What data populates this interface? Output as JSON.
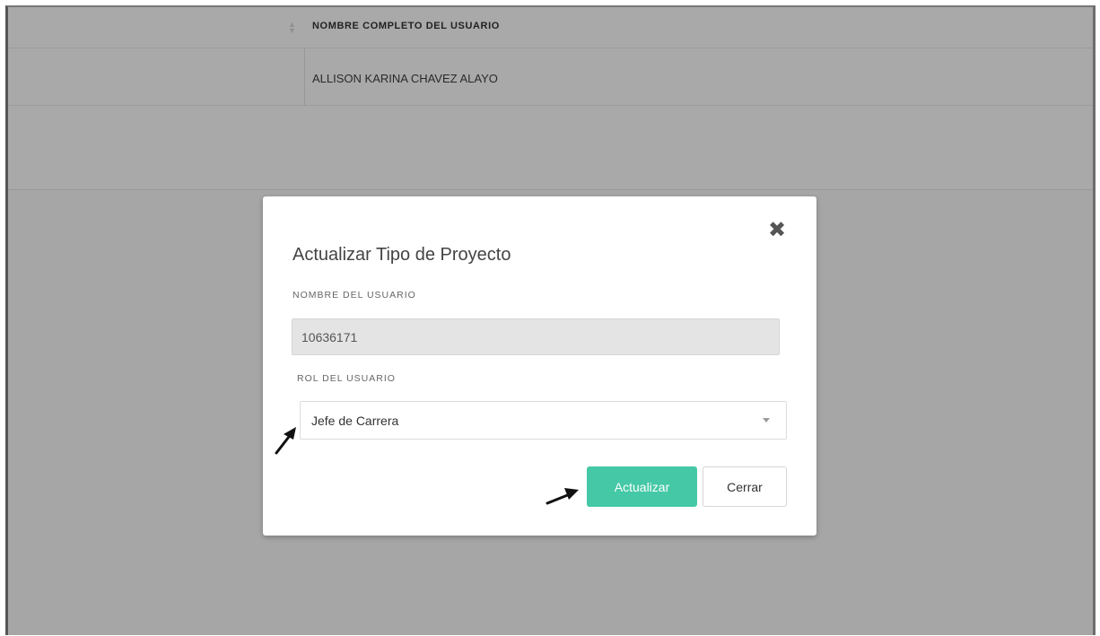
{
  "table": {
    "header": "NOMBRE COMPLETO DEL USUARIO",
    "rows": [
      "ALLISON KARINA CHAVEZ ALAYO"
    ]
  },
  "modal": {
    "title": "Actualizar Tipo de Proyecto",
    "close_icon": "close-x-icon",
    "user_label": "NOMBRE DEL USUARIO",
    "user_value": "10636171",
    "rol_label": "ROL DEL USUARIO",
    "rol_selected": "Jefe de Carrera",
    "update_label": "Actualizar",
    "close_label": "Cerrar"
  },
  "colors": {
    "overlay": "#a6a6a6",
    "accent": "#45c8a6"
  }
}
